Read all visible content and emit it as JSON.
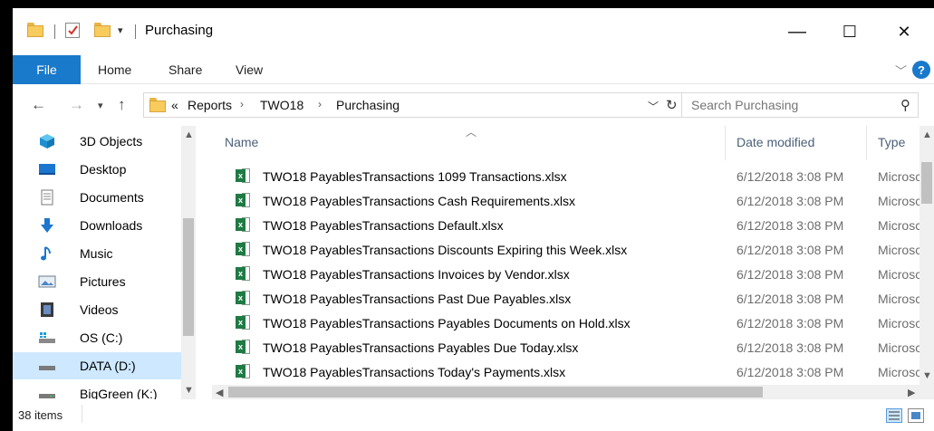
{
  "window": {
    "title": "Purchasing",
    "controls": {
      "minimize": "—",
      "maximize": "☐",
      "close": "✕"
    }
  },
  "ribbon": {
    "tabs": [
      "File",
      "Home",
      "Share",
      "View"
    ],
    "help": "?"
  },
  "address": {
    "overflow": "«",
    "crumbs": [
      "Reports",
      "TWO18",
      "Purchasing"
    ]
  },
  "search": {
    "placeholder": "Search Purchasing"
  },
  "nav_pane": {
    "items": [
      {
        "label": "3D Objects",
        "icon": "3d-objects-icon"
      },
      {
        "label": "Desktop",
        "icon": "desktop-icon"
      },
      {
        "label": "Documents",
        "icon": "documents-icon"
      },
      {
        "label": "Downloads",
        "icon": "downloads-icon"
      },
      {
        "label": "Music",
        "icon": "music-icon"
      },
      {
        "label": "Pictures",
        "icon": "pictures-icon"
      },
      {
        "label": "Videos",
        "icon": "videos-icon"
      },
      {
        "label": "OS (C:)",
        "icon": "os-drive-icon"
      },
      {
        "label": "DATA (D:)",
        "icon": "drive-icon",
        "selected": true
      },
      {
        "label": "BigGreen (K:)",
        "icon": "network-drive-icon"
      }
    ]
  },
  "columns": {
    "name": "Name",
    "date": "Date modified",
    "type": "Type"
  },
  "files": [
    {
      "name": "TWO18 PayablesTransactions 1099 Transactions.xlsx",
      "date": "6/12/2018 3:08 PM",
      "type": "Microsc"
    },
    {
      "name": "TWO18 PayablesTransactions Cash Requirements.xlsx",
      "date": "6/12/2018 3:08 PM",
      "type": "Microsc"
    },
    {
      "name": "TWO18 PayablesTransactions Default.xlsx",
      "date": "6/12/2018 3:08 PM",
      "type": "Microsc"
    },
    {
      "name": "TWO18 PayablesTransactions Discounts Expiring this Week.xlsx",
      "date": "6/12/2018 3:08 PM",
      "type": "Microsc"
    },
    {
      "name": "TWO18 PayablesTransactions Invoices by Vendor.xlsx",
      "date": "6/12/2018 3:08 PM",
      "type": "Microsc"
    },
    {
      "name": "TWO18 PayablesTransactions Past Due Payables.xlsx",
      "date": "6/12/2018 3:08 PM",
      "type": "Microsc"
    },
    {
      "name": "TWO18 PayablesTransactions Payables Documents on Hold.xlsx",
      "date": "6/12/2018 3:08 PM",
      "type": "Microsc"
    },
    {
      "name": "TWO18 PayablesTransactions Payables Due Today.xlsx",
      "date": "6/12/2018 3:08 PM",
      "type": "Microsc"
    },
    {
      "name": "TWO18 PayablesTransactions Today's Payments.xlsx",
      "date": "6/12/2018 3:08 PM",
      "type": "Microsc"
    }
  ],
  "status": {
    "count": "38 items"
  },
  "colors": {
    "accent": "#1979ca",
    "selected": "#cde8ff",
    "excel_green": "#1f7a44"
  }
}
